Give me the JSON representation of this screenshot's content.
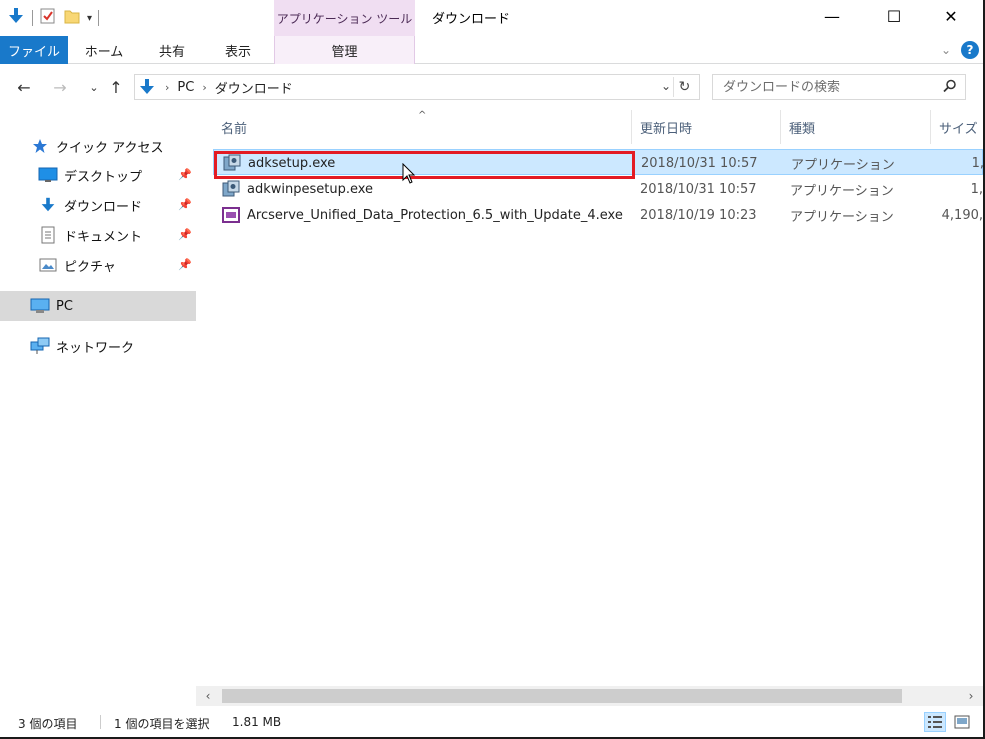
{
  "window": {
    "title": "ダウンロード",
    "context_tab_header": "アプリケーション ツール",
    "minimize": "—",
    "maximize": "☐",
    "close": "✕"
  },
  "ribbon": {
    "tabs": [
      "ファイル",
      "ホーム",
      "共有",
      "表示",
      "管理"
    ],
    "help": "?"
  },
  "address": {
    "breadcrumb": [
      "PC",
      "ダウンロード"
    ],
    "search_placeholder": "ダウンロードの検索"
  },
  "navigation": {
    "quick_access": "クイック アクセス",
    "items": [
      {
        "label": "デスクトップ",
        "icon": "desktop-icon",
        "pinned": true
      },
      {
        "label": "ダウンロード",
        "icon": "download-arrow-icon",
        "pinned": true
      },
      {
        "label": "ドキュメント",
        "icon": "document-icon",
        "pinned": true
      },
      {
        "label": "ピクチャ",
        "icon": "picture-icon",
        "pinned": true
      }
    ],
    "pc": "PC",
    "network": "ネットワーク"
  },
  "columns": {
    "name": "名前",
    "modified": "更新日時",
    "type": "種類",
    "size": "サイズ"
  },
  "files": [
    {
      "name": "adksetup.exe",
      "modified": "2018/10/31 10:57",
      "type": "アプリケーション",
      "size": "1,",
      "selected": true,
      "icon": "installer-icon"
    },
    {
      "name": "adkwinpesetup.exe",
      "modified": "2018/10/31 10:57",
      "type": "アプリケーション",
      "size": "1,",
      "selected": false,
      "icon": "installer-icon"
    },
    {
      "name": "Arcserve_Unified_Data_Protection_6.5_with_Update_4.exe",
      "modified": "2018/10/19 10:23",
      "type": "アプリケーション",
      "size": "4,190,",
      "selected": false,
      "icon": "app-window-icon"
    }
  ],
  "status": {
    "item_count": "3 個の項目",
    "selection": "1 個の項目を選択",
    "selection_size": "1.81 MB"
  },
  "colors": {
    "file_tab": "#1979ca",
    "context_tab": "#f0def2",
    "selection": "#cce8ff",
    "highlight_border": "#e31b23"
  }
}
